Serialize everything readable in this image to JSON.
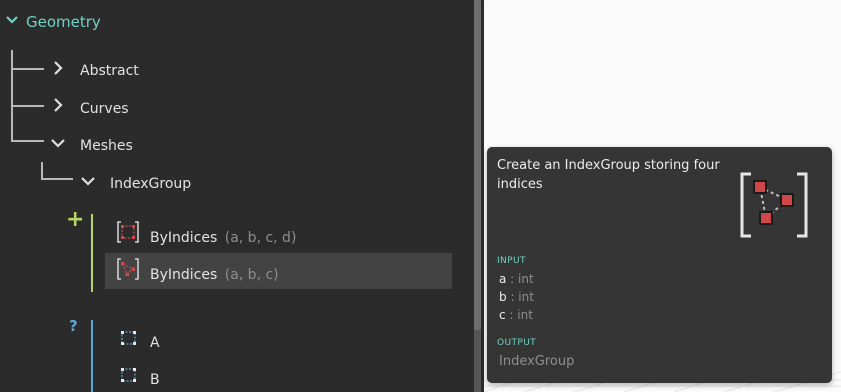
{
  "library": {
    "root": {
      "label": "Geometry"
    },
    "categories": [
      {
        "label": "Abstract"
      },
      {
        "label": "Curves"
      },
      {
        "label": "Meshes"
      }
    ],
    "subcategory": {
      "label": "IndexGroup"
    },
    "create_section": {
      "marker": "+",
      "items": [
        {
          "label": "ByIndices",
          "params": "(a, b, c, d)"
        },
        {
          "label": "ByIndices",
          "params": "(a, b, c)"
        }
      ]
    },
    "query_section": {
      "marker": "?",
      "items": [
        {
          "label": "A"
        },
        {
          "label": "B"
        }
      ]
    }
  },
  "tooltip": {
    "description": "Create an IndexGroup storing four indices",
    "input_heading": "INPUT",
    "inputs": [
      {
        "name": "a",
        "sep": " : ",
        "type": "int"
      },
      {
        "name": "b",
        "sep": " : ",
        "type": "int"
      },
      {
        "name": "c",
        "sep": " : ",
        "type": "int"
      }
    ],
    "output_heading": "OUTPUT",
    "output_type": "IndexGroup"
  },
  "colors": {
    "panel_bg": "#2b2b2b",
    "accent_teal": "#6ed3c5",
    "create_marker": "#b6d568",
    "query_marker": "#5aa7d8",
    "hover_bg": "#434343",
    "tooltip_bg": "#353535",
    "node_red": "#d04747"
  }
}
